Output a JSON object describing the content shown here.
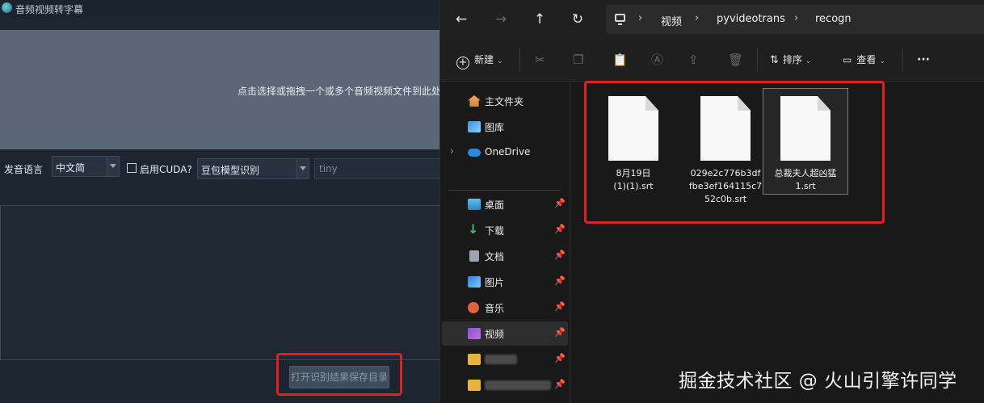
{
  "app": {
    "title": "音频视频转字幕",
    "dropzone_text": "点击选择或拖拽一个或多个音频视频文件到此处",
    "language_label": "发音语言",
    "language_value": "中文简",
    "cuda_label": "启用CUDA?",
    "cuda_checked": false,
    "model_value": "豆包模型识别",
    "model_size": "tiny",
    "open_button": "打开识别结果保存目录"
  },
  "explorer": {
    "breadcrumb": [
      "视频",
      "pyvideotrans",
      "recogn"
    ],
    "toolbar": {
      "new_label": "新建",
      "sort_label": "排序",
      "view_label": "查看",
      "more_label": "···"
    },
    "nav_items": [
      {
        "label": "主文件夹",
        "icon": "home-icon",
        "pinned": false
      },
      {
        "label": "图库",
        "icon": "gallery-icon",
        "pinned": false
      },
      {
        "label": "OneDrive",
        "icon": "cloud-icon",
        "pinned": false
      },
      {
        "label": "桌面",
        "icon": "desktop-icon",
        "pinned": true
      },
      {
        "label": "下载",
        "icon": "download-icon",
        "pinned": true
      },
      {
        "label": "文档",
        "icon": "document-icon",
        "pinned": true
      },
      {
        "label": "图片",
        "icon": "picture-icon",
        "pinned": true
      },
      {
        "label": "音乐",
        "icon": "music-icon",
        "pinned": true
      },
      {
        "label": "视频",
        "icon": "video-icon",
        "pinned": true
      }
    ],
    "files": [
      {
        "name_lines": [
          "8月19日",
          "(1)(1).srt"
        ],
        "selected": false
      },
      {
        "name_lines": [
          "029e2c776b3df",
          "fbe3ef164115c7",
          "52c0b.srt"
        ],
        "selected": false
      },
      {
        "name_lines": [
          "总裁夫人超凶猛",
          "1.srt"
        ],
        "selected": true
      }
    ]
  },
  "watermark": "掘金技术社区 @ 火山引擎许同学",
  "colors": {
    "highlight": "#e02020",
    "app_bg": "#1d2530",
    "explorer_bg": "#191919"
  }
}
